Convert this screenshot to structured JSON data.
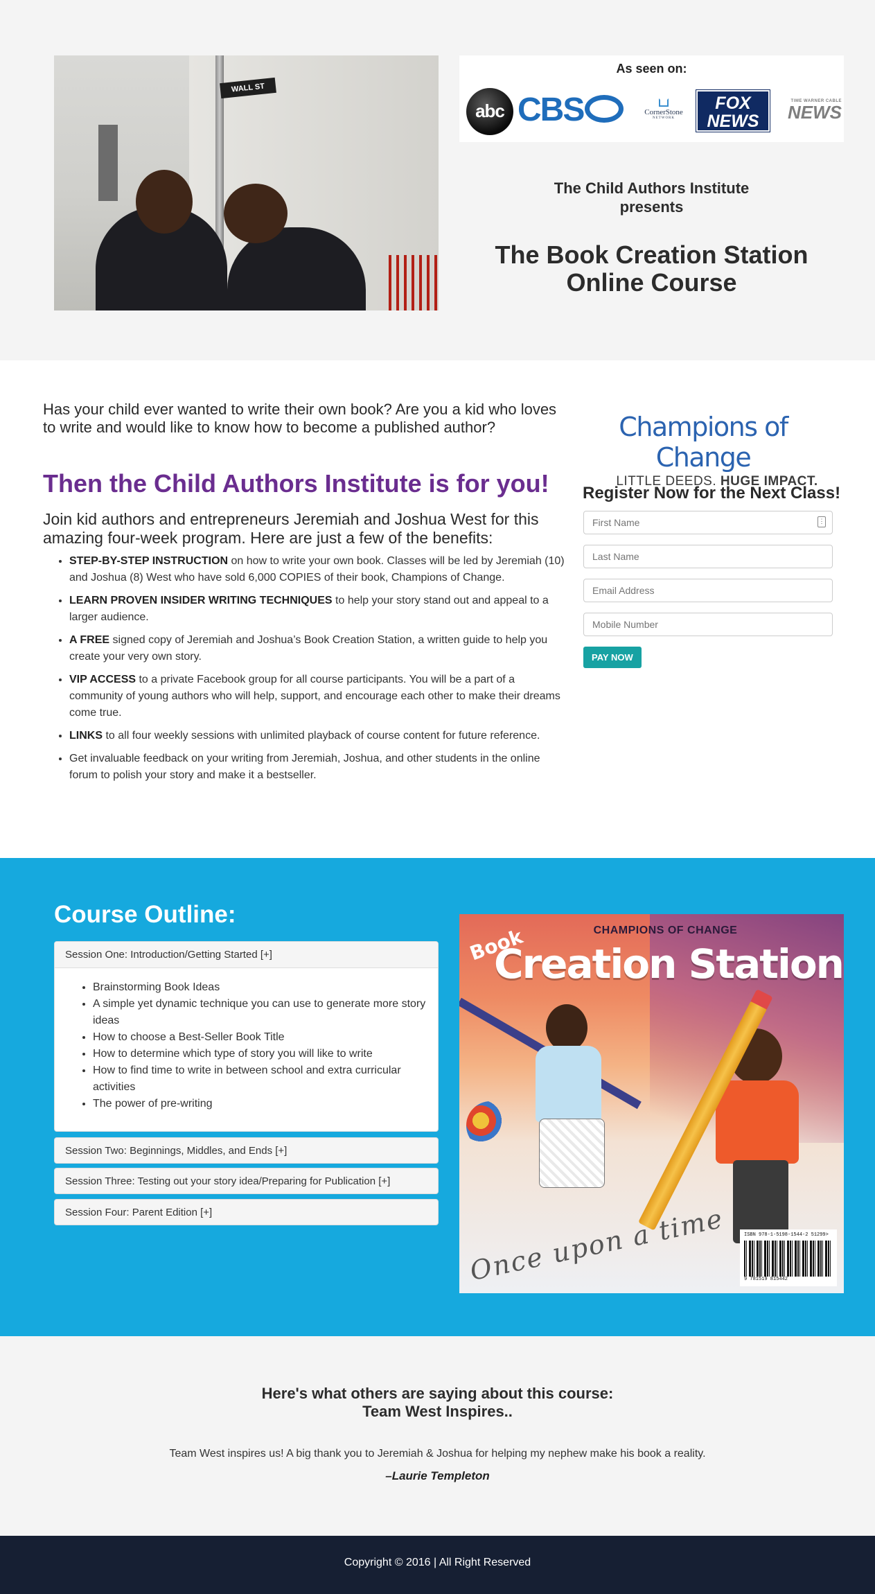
{
  "hero": {
    "seen_on_title": "As seen on:",
    "logos": {
      "abc": "abc",
      "cbs": "CBS",
      "cornerstone": "CornerStone",
      "cornerstone_sub": "NETWORK",
      "fox_line1": "FOX",
      "fox_line2": "NEWS",
      "twc_small": "TIME WARNER CABLE",
      "twc": "NEWS"
    },
    "photo_sign": "WALL ST",
    "presents_line1": "The Child Authors Institute",
    "presents_line2": "presents",
    "course_title_line1": "The Book Creation Station",
    "course_title_line2": "Online Course"
  },
  "intro": {
    "question": "Has your child ever wanted to write their own book? Are you a kid who loves to write and would like to know how to become a published author?",
    "highlight": "Then the Child Authors Institute is for you!",
    "lead": "Join kid authors and entrepreneurs Jeremiah and Joshua West for this amazing four-week program. Here are just a few of the benefits:",
    "benefits": [
      {
        "bold": "STEP-BY-STEP INSTRUCTION",
        "text": " on how to write your own book. Classes will be led by Jeremiah (10) and Joshua (8) West who have sold 6,000 COPIES of their book, Champions of Change."
      },
      {
        "bold": "LEARN PROVEN INSIDER WRITING TECHNIQUES",
        "text": " to help your story stand out and appeal to a larger audience."
      },
      {
        "bold": "A FREE",
        "text": " signed copy of Jeremiah and Joshua’s Book Creation Station, a written guide to help you create your very own story."
      },
      {
        "bold": "VIP ACCESS",
        "text": " to a private Facebook group for all course participants. You will be a part of a community of young authors who will help, support, and encourage each other to make their dreams come true."
      },
      {
        "bold": "LINKS",
        "text": " to all four weekly sessions with unlimited playback of course content for future reference."
      },
      {
        "bold": "",
        "text": "Get invaluable feedback on your writing from Jeremiah, Joshua, and other students in the online forum to polish your story and make it a bestseller."
      }
    ]
  },
  "signup": {
    "brand_name": "Champions of Change",
    "brand_tag_plain": "LITTLE DEEDS. ",
    "brand_tag_bold": "HUGE IMPACT.",
    "title": "Register Now for the Next Class!",
    "first_name_placeholder": "First Name",
    "last_name_placeholder": "Last Name",
    "email_placeholder": "Email Address",
    "mobile_placeholder": "Mobile Number",
    "pay_button": "PAY NOW"
  },
  "outline": {
    "title": "Course Outline:",
    "sessions": [
      {
        "title": "Session One: Introduction/Getting Started [+]",
        "items": [
          "Brainstorming Book Ideas",
          "A simple yet dynamic technique you can use to generate more story ideas",
          "How to choose a Best-Seller Book Title",
          "How to determine which type of story you will like to write",
          "How to find time to write in between school and extra curricular activities",
          "The power of pre-writing"
        ]
      },
      {
        "title": "Session Two: Beginnings, Middles, and Ends [+]"
      },
      {
        "title": "Session Three: Testing out your story idea/Preparing for Publication [+]"
      },
      {
        "title": "Session Four: Parent Edition [+]"
      }
    ],
    "book": {
      "brand": "CHAMPIONS OF CHANGE",
      "word": "Book",
      "title": "Creation Station",
      "script": "Once upon a time",
      "isbn": "ISBN 978-1-5198-1544-2",
      "price_code": "51299>",
      "barcode_digits": "9 781519 815442"
    }
  },
  "testimonial": {
    "heading_line1": "Here's what others are saying about this course:",
    "heading_line2": "Team West Inspires..",
    "quote": "Team West inspires us! A big thank you to Jeremiah & Joshua for helping my nephew make his book a reality.",
    "author": "–Laurie Templeton"
  },
  "footer": {
    "text": "Copyright © 2016 | All Right Reserved"
  },
  "colors": {
    "hero_bg": "#f4f4f4",
    "highlight_purple": "#6a2d8f",
    "outline_blue": "#16a9de",
    "pay_button_teal": "#17a2a3",
    "footer_navy": "#161f33",
    "brand_blue": "#2b63b0"
  }
}
